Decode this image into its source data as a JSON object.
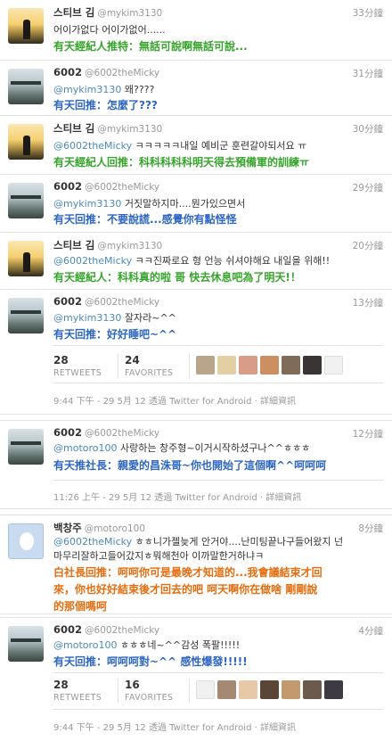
{
  "tweets": [
    {
      "name": "스티브 김",
      "handle": "@mykim3130",
      "time": "33分鐘",
      "text": "어이가없다 어이가없어......",
      "translation": "有天經紀人推特：無話可說啊無話可說..."
    },
    {
      "name": "6002",
      "handle": "@6002theMicky",
      "time": "31分鐘",
      "mention": "@mykim3130",
      "text": "왜????",
      "translation": "有天回推：怎麼了???"
    },
    {
      "name": "스티브 김",
      "handle": "@mykim3130",
      "time": "30分鐘",
      "mention": "@6002theMicky",
      "text": "ㅋㅋㅋㅋㅋ내일 예비군 훈련갈야되서요 ㅠ",
      "translation": "有天經紀人回推：科科科科科明天得去預備軍的訓練ㅠ"
    },
    {
      "name": "6002",
      "handle": "@6002theMicky",
      "time": "29分鐘",
      "mention": "@mykim3130",
      "text": "거짓말하지마....뭔가있으면서",
      "translation": "有天回推：不要說謊...感覺你有點怪怪"
    },
    {
      "name": "스티브 김",
      "handle": "@mykim3130",
      "time": "20分鐘",
      "mention": "@6002theMicky",
      "text": "ㅋㅋ진짜로요 형 언능 쉬셔야해요 내일을 위해!!",
      "translation": "有天經紀人：科科真的啦 哥 快去休息吧為了明天!！"
    },
    {
      "name": "6002",
      "handle": "@6002theMicky",
      "time": "13分鐘",
      "mention": "@mykim3130",
      "text": "잘자라~^^",
      "translation": "有天回推：好好睡吧~^^",
      "retweets": "28",
      "retweets_label": "RETWEETS",
      "favorites": "24",
      "favorites_label": "FAVORITES",
      "meta": "9:44 下午 - 29 5月 12 透過 Twitter for Android · 詳細資訊"
    },
    {
      "name": "6002",
      "handle": "@6002theMicky",
      "time": "12分鐘",
      "mention": "@motoro100",
      "text": "사랑하는 창주형~이거시작하셨구나^^ㅎㅎㅎ",
      "translation": "有天推社長：親愛的昌洙哥~你也開始了這個啊^^呵呵呵",
      "meta": "11:26 上午 - 29 5月 12 透過 Twitter for Android · 詳細資訊"
    },
    {
      "name": "백창주",
      "handle": "@motoro100",
      "time": "8分鐘",
      "mention": "@6002theMicky",
      "text": "ㅎㅎ니가젤늦게 안거야....난미팅끝나구들어왔지 넌",
      "text2": "마무리잘하고들어갔지ㅎ뭐해천아 이까말한거하냐ㅋ",
      "translation": "白社長回推：呵呵你可是最晚才知道的...我會議結束才回",
      "translation2": "來，你也好好結束後才回去的吧 呵天啊你在做啥 剛剛說",
      "translation3": "的那個嗎呵"
    },
    {
      "name": "6002",
      "handle": "@6002theMicky",
      "time": "4分鐘",
      "mention": "@motoro100",
      "text": "ㅎㅎㅎ네~^^감성 폭팔!!!!!",
      "translation": "有天回推：呵呵呵對~^^ 感性爆發!!!!!",
      "retweets": "28",
      "retweets_label": "RETWEETS",
      "favorites": "16",
      "favorites_label": "FAVORITES",
      "meta": "9:44 下午 - 29 5月 12 透過 Twitter for Android · 詳細資訊"
    }
  ],
  "colors": {
    "translation_green": "#36a52b",
    "translation_blue": "#2d66c5",
    "translation_orange": "#e86b0c",
    "mention": "#4b8ab8"
  }
}
